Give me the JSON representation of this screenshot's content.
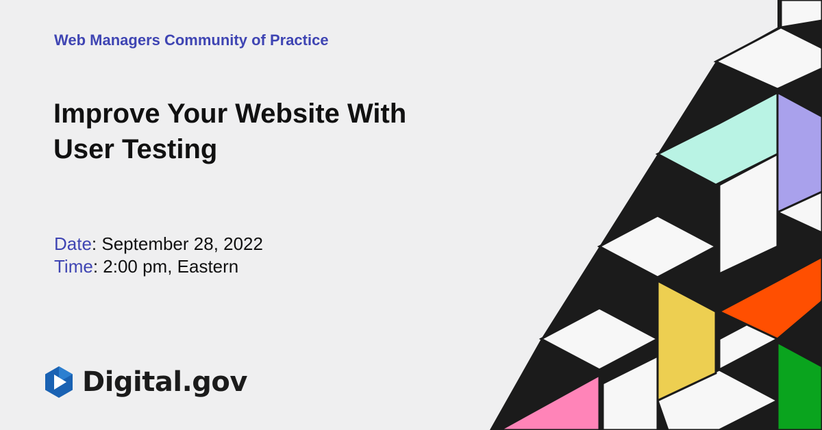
{
  "eyebrow": "Web Managers Community of Practice",
  "title": {
    "line1": "Improve Your Website With",
    "line2": "User Testing"
  },
  "details": {
    "date_label": "Date",
    "date_value": ": September 28, 2022",
    "time_label": "Time",
    "time_value": ": 2:00 pm, Eastern"
  },
  "logo": {
    "text": "Digital.gov",
    "icon": "play-hexagon-icon"
  },
  "colors": {
    "background": "#efeff0",
    "accent_blue": "#3f45b3",
    "mint": "#b9f3e4",
    "lavender": "#a9a1ec",
    "orange": "#ff4f01",
    "yellow": "#edcf51",
    "green": "#0aa41e",
    "pink": "#ff84b8",
    "dark": "#1b1b1b"
  }
}
